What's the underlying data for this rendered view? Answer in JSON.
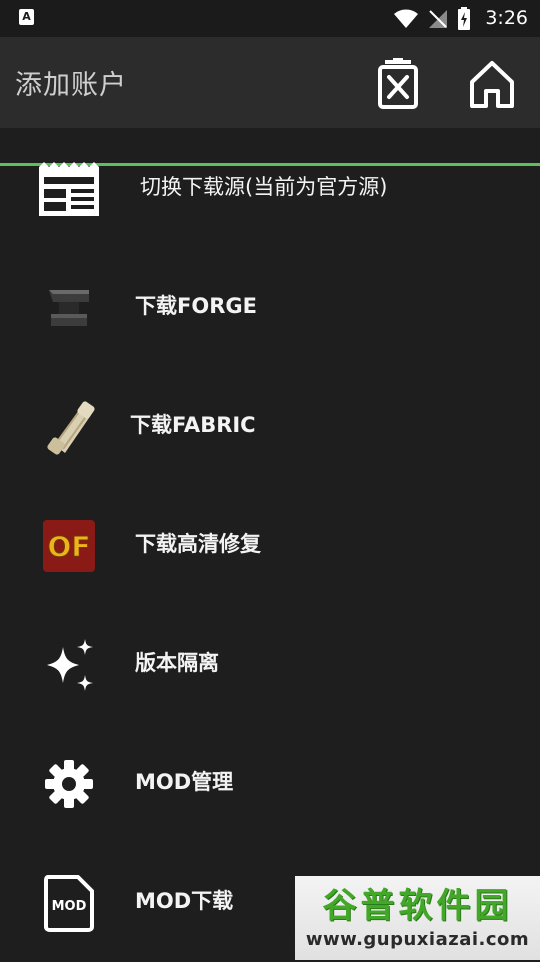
{
  "status_bar": {
    "left_icon_letter": "A",
    "time": "3:26"
  },
  "header": {
    "title": "添加账户"
  },
  "menu": {
    "items": [
      {
        "label": "切换下载源(当前为官方源)"
      },
      {
        "label": "下载FORGE"
      },
      {
        "label": "下载FABRIC"
      },
      {
        "label": "下载高清修复"
      },
      {
        "label": "版本隔离"
      },
      {
        "label": "MOD管理"
      },
      {
        "label": "MOD下载"
      }
    ]
  },
  "icons": {
    "optifine_text": "OF",
    "mod_file_text": "MOD"
  },
  "watermark": {
    "brand": "谷普软件园",
    "url": "www.gupuxiazai.com"
  },
  "colors": {
    "background": "#1e1e1e",
    "app_bar": "#2c2c2c",
    "accent_green": "#5cc15b",
    "text": "#f3f3f3"
  }
}
